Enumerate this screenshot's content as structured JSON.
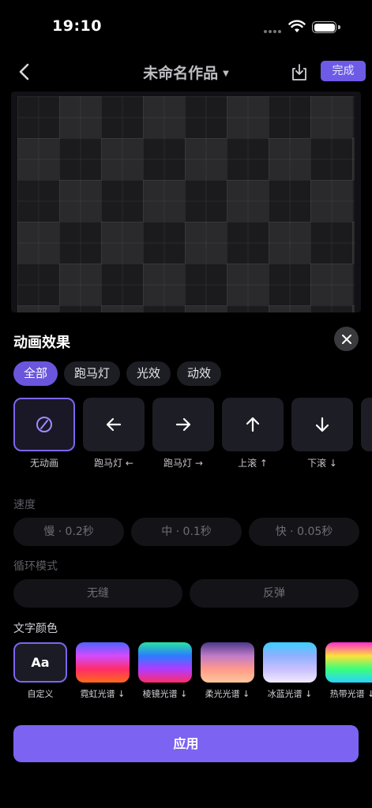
{
  "status": {
    "time": "19:10"
  },
  "nav": {
    "title": "未命名作品",
    "done_label": "完成"
  },
  "panel": {
    "title": "动画效果",
    "tabs": [
      {
        "label": "全部",
        "active": true
      },
      {
        "label": "跑马灯",
        "active": false
      },
      {
        "label": "光效",
        "active": false
      },
      {
        "label": "动效",
        "active": false
      }
    ],
    "effects": [
      {
        "label": "无动画",
        "icon": "no-animation-icon",
        "selected": true
      },
      {
        "label": "跑马灯 ←",
        "icon": "arrow-left-icon",
        "selected": false
      },
      {
        "label": "跑马灯 →",
        "icon": "arrow-right-icon",
        "selected": false
      },
      {
        "label": "上滚 ↑",
        "icon": "arrow-up-icon",
        "selected": false
      },
      {
        "label": "下滚 ↓",
        "icon": "arrow-down-icon",
        "selected": false
      },
      {
        "label": "",
        "icon": "more-effect",
        "selected": false
      }
    ],
    "speed": {
      "label": "速度",
      "options": [
        "慢 · 0.2秒",
        "中 · 0.1秒",
        "快 · 0.05秒"
      ]
    },
    "loop": {
      "label": "循环模式",
      "options": [
        "无缝",
        "反弹"
      ]
    },
    "text_color": {
      "label": "文字颜色",
      "custom_glyph": "Aa",
      "items": [
        {
          "label": "自定义",
          "custom": true
        },
        {
          "label": "霓虹光谱 ↓",
          "gradient": [
            "#4f63ff",
            "#d34bff",
            "#ff2d6a",
            "#ff6a1a"
          ]
        },
        {
          "label": "棱镜光谱 ↓",
          "gradient": [
            "#27e3a0",
            "#2b7cff",
            "#b23bff",
            "#ff2d6a"
          ]
        },
        {
          "label": "柔光光谱 ↓",
          "gradient": [
            "#4a3a8a",
            "#c07ac8",
            "#ff9a8a",
            "#ffc89a"
          ]
        },
        {
          "label": "冰蓝光谱 ↓",
          "gradient": [
            "#3ad0ff",
            "#8fb0ff",
            "#c8c0ff",
            "#f2eaff"
          ]
        },
        {
          "label": "热带光谱 ↓",
          "gradient": [
            "#ff2dcf",
            "#ffe03a",
            "#3aff7a",
            "#2bd0ff"
          ]
        }
      ]
    },
    "apply_label": "应用"
  }
}
